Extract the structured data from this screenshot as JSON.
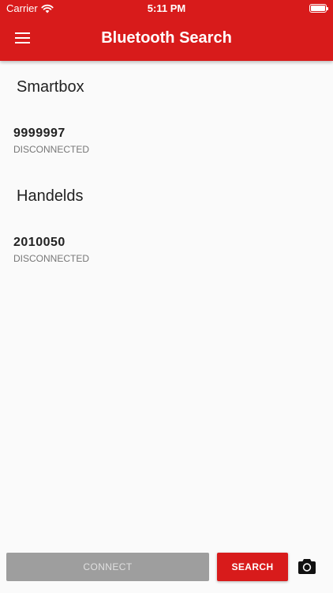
{
  "status_bar": {
    "carrier": "Carrier",
    "time": "5:11 PM"
  },
  "app_bar": {
    "title": "Bluetooth Search",
    "color": "#d81b1b"
  },
  "sections": [
    {
      "title": "Smartbox",
      "devices": [
        {
          "name": "9999997",
          "status": "DISCONNECTED"
        }
      ]
    },
    {
      "title": "Handelds",
      "devices": [
        {
          "name": "2010050",
          "status": "DISCONNECTED"
        }
      ]
    }
  ],
  "actions": {
    "connect_label": "CONNECT",
    "search_label": "SEARCH",
    "camera_icon": "camera-icon"
  }
}
